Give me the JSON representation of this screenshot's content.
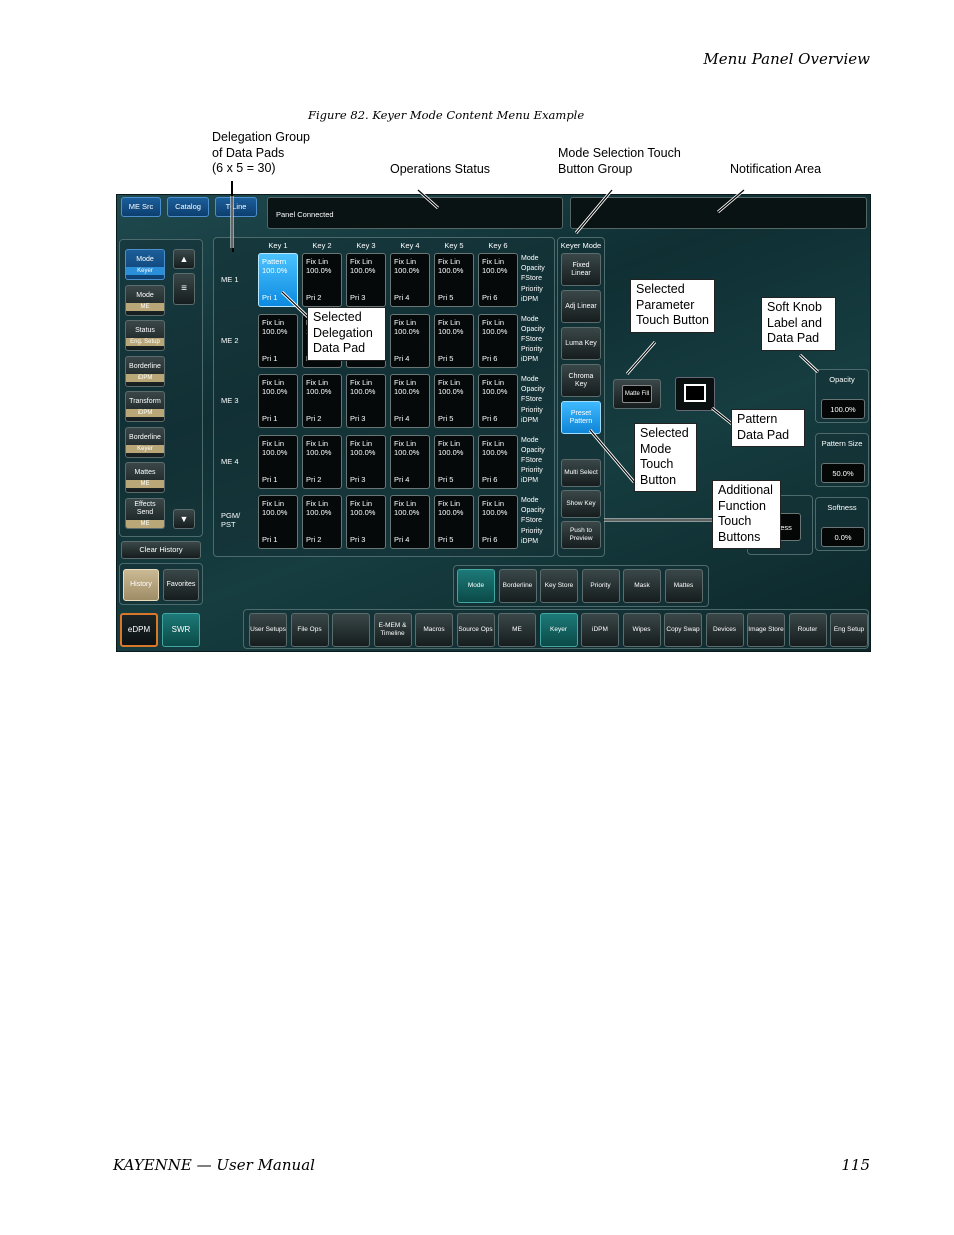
{
  "page": {
    "header_title": "Menu Panel Overview",
    "figure_caption": "Figure 82.  Keyer Mode Content Menu Example",
    "footer_left": "KAYENNE  —  User Manual",
    "footer_right": "115"
  },
  "callouts": {
    "delegation_group": "Delegation Group\nof Data Pads\n(6 x 5 = 30)",
    "operations_status": "Operations Status",
    "mode_selection": "Mode Selection Touch\nButton Group",
    "notification_area": "Notification Area",
    "selected_delegation": "Selected\nDelegation\nData Pad",
    "selected_parameter": "Selected\nParameter\nTouch Button",
    "soft_knob": "Soft Knob\nLabel and\nData Pad",
    "pattern_data_pad": "Pattern\nData Pad",
    "selected_mode": "Selected\nMode\nTouch\nButton",
    "additional_function": "Additional\nFunction\nTouch\nButtons"
  },
  "screen": {
    "top_tabs": [
      "ME Src",
      "Catalog",
      "T-Line"
    ],
    "status_text": "Panel Connected",
    "notification_text": "",
    "left_history": [
      {
        "label": "Mode",
        "sub": "Keyer",
        "selected": true
      },
      {
        "label": "Mode",
        "sub": "ME",
        "selected": false
      },
      {
        "label": "Status",
        "sub": "Eng. Setup",
        "selected": false
      },
      {
        "label": "Borderline",
        "sub": "iDPM",
        "selected": false
      },
      {
        "label": "Transform",
        "sub": "iDPM",
        "selected": false
      },
      {
        "label": "Borderline",
        "sub": "Keyer",
        "selected": false
      },
      {
        "label": "Mattes",
        "sub": "ME",
        "selected": false
      },
      {
        "label": "Effects Send",
        "sub": "ME",
        "selected": false
      }
    ],
    "clear_history": "Clear History",
    "history_btn": "History",
    "favorites_btn": "Favorites",
    "edpm_btn": "eDPM",
    "swr_btn": "SWR",
    "key_headers": [
      "Key 1",
      "Key 2",
      "Key 3",
      "Key 4",
      "Key 5",
      "Key 6"
    ],
    "rows": [
      {
        "label": "ME 1",
        "pads": [
          {
            "mode": "Pattern",
            "pct": "100.0%",
            "pri": "Pri 1",
            "selected": true
          },
          {
            "mode": "Fix Lin",
            "pct": "100.0%",
            "pri": "Pri 2"
          },
          {
            "mode": "Fix Lin",
            "pct": "100.0%",
            "pri": "Pri 3"
          },
          {
            "mode": "Fix Lin",
            "pct": "100.0%",
            "pri": "Pri 4"
          },
          {
            "mode": "Fix Lin",
            "pct": "100.0%",
            "pri": "Pri 5"
          },
          {
            "mode": "Fix Lin",
            "pct": "100.0%",
            "pri": "Pri 6"
          }
        ]
      },
      {
        "label": "ME 2",
        "pads": [
          {
            "mode": "Fix Lin",
            "pct": "100.0%",
            "pri": "Pri 1"
          },
          {
            "mode": "Fix Lin",
            "pct": "100.0%",
            "pri": "Pri 2"
          },
          {
            "mode": "Fix Lin",
            "pct": "100.0%",
            "pri": "Pri 3"
          },
          {
            "mode": "Fix Lin",
            "pct": "100.0%",
            "pri": "Pri 4"
          },
          {
            "mode": "Fix Lin",
            "pct": "100.0%",
            "pri": "Pri 5"
          },
          {
            "mode": "Fix Lin",
            "pct": "100.0%",
            "pri": "Pri 6"
          }
        ]
      },
      {
        "label": "ME 3",
        "pads": [
          {
            "mode": "Fix Lin",
            "pct": "100.0%",
            "pri": "Pri 1"
          },
          {
            "mode": "Fix Lin",
            "pct": "100.0%",
            "pri": "Pri 2"
          },
          {
            "mode": "Fix Lin",
            "pct": "100.0%",
            "pri": "Pri 3"
          },
          {
            "mode": "Fix Lin",
            "pct": "100.0%",
            "pri": "Pri 4"
          },
          {
            "mode": "Fix Lin",
            "pct": "100.0%",
            "pri": "Pri 5"
          },
          {
            "mode": "Fix Lin",
            "pct": "100.0%",
            "pri": "Pri 6"
          }
        ]
      },
      {
        "label": "ME 4",
        "pads": [
          {
            "mode": "Fix Lin",
            "pct": "100.0%",
            "pri": "Pri 1"
          },
          {
            "mode": "Fix Lin",
            "pct": "100.0%",
            "pri": "Pri 2"
          },
          {
            "mode": "Fix Lin",
            "pct": "100.0%",
            "pri": "Pri 3"
          },
          {
            "mode": "Fix Lin",
            "pct": "100.0%",
            "pri": "Pri 4"
          },
          {
            "mode": "Fix Lin",
            "pct": "100.0%",
            "pri": "Pri 5"
          },
          {
            "mode": "Fix Lin",
            "pct": "100.0%",
            "pri": "Pri 6"
          }
        ]
      },
      {
        "label": "PGM/\nPST",
        "pads": [
          {
            "mode": "Fix Lin",
            "pct": "100.0%",
            "pri": "Pri 1"
          },
          {
            "mode": "Fix Lin",
            "pct": "100.0%",
            "pri": "Pri 2"
          },
          {
            "mode": "Fix Lin",
            "pct": "100.0%",
            "pri": "Pri 3"
          },
          {
            "mode": "Fix Lin",
            "pct": "100.0%",
            "pri": "Pri 4"
          },
          {
            "mode": "Fix Lin",
            "pct": "100.0%",
            "pri": "Pri 5"
          },
          {
            "mode": "Fix Lin",
            "pct": "100.0%",
            "pri": "Pri 6"
          }
        ]
      }
    ],
    "row_attrs": [
      "Mode",
      "Opacity",
      "FStore",
      "Priority",
      "iDPM"
    ],
    "keyer_mode_title": "Keyer Mode",
    "keyer_modes": [
      {
        "label": "Fixed Linear",
        "selected": false
      },
      {
        "label": "Adj Linear",
        "selected": false
      },
      {
        "label": "Luma Key",
        "selected": false
      },
      {
        "label": "Chroma Key",
        "selected": false
      },
      {
        "label": "Preset Pattern",
        "selected": true
      }
    ],
    "extra_buttons": [
      "Multi Select",
      "Show Key",
      "Push to Preview"
    ],
    "matte_fill": "Matte Fill",
    "softness_partial": "ness",
    "knobs": [
      {
        "label": "Opacity",
        "value": "100.0%"
      },
      {
        "label": "Pattern Size",
        "value": "50.0%"
      },
      {
        "label": "Softness",
        "value": "0.0%"
      }
    ],
    "subtabs": [
      {
        "label": "Mode",
        "selected": true
      },
      {
        "label": "Borderline",
        "selected": false
      },
      {
        "label": "Key Store",
        "selected": false
      },
      {
        "label": "Priority",
        "selected": false
      },
      {
        "label": "Mask",
        "selected": false
      },
      {
        "label": "Mattes",
        "selected": false
      }
    ],
    "bottom_nav": [
      {
        "label": "User Setups",
        "selected": false
      },
      {
        "label": "File Ops",
        "selected": false
      },
      {
        "label": "",
        "selected": false
      },
      {
        "label": "E-MEM & Timeline",
        "selected": false
      },
      {
        "label": "Macros",
        "selected": false
      },
      {
        "label": "Source Ops",
        "selected": false
      },
      {
        "label": "ME",
        "selected": false
      },
      {
        "label": "Keyer",
        "selected": true
      },
      {
        "label": "iDPM",
        "selected": false
      },
      {
        "label": "Wipes",
        "selected": false
      },
      {
        "label": "Copy Swap",
        "selected": false
      },
      {
        "label": "Devices",
        "selected": false
      },
      {
        "label": "Image Store",
        "selected": false
      },
      {
        "label": "Router",
        "selected": false
      },
      {
        "label": "Eng Setup",
        "selected": false
      }
    ]
  }
}
